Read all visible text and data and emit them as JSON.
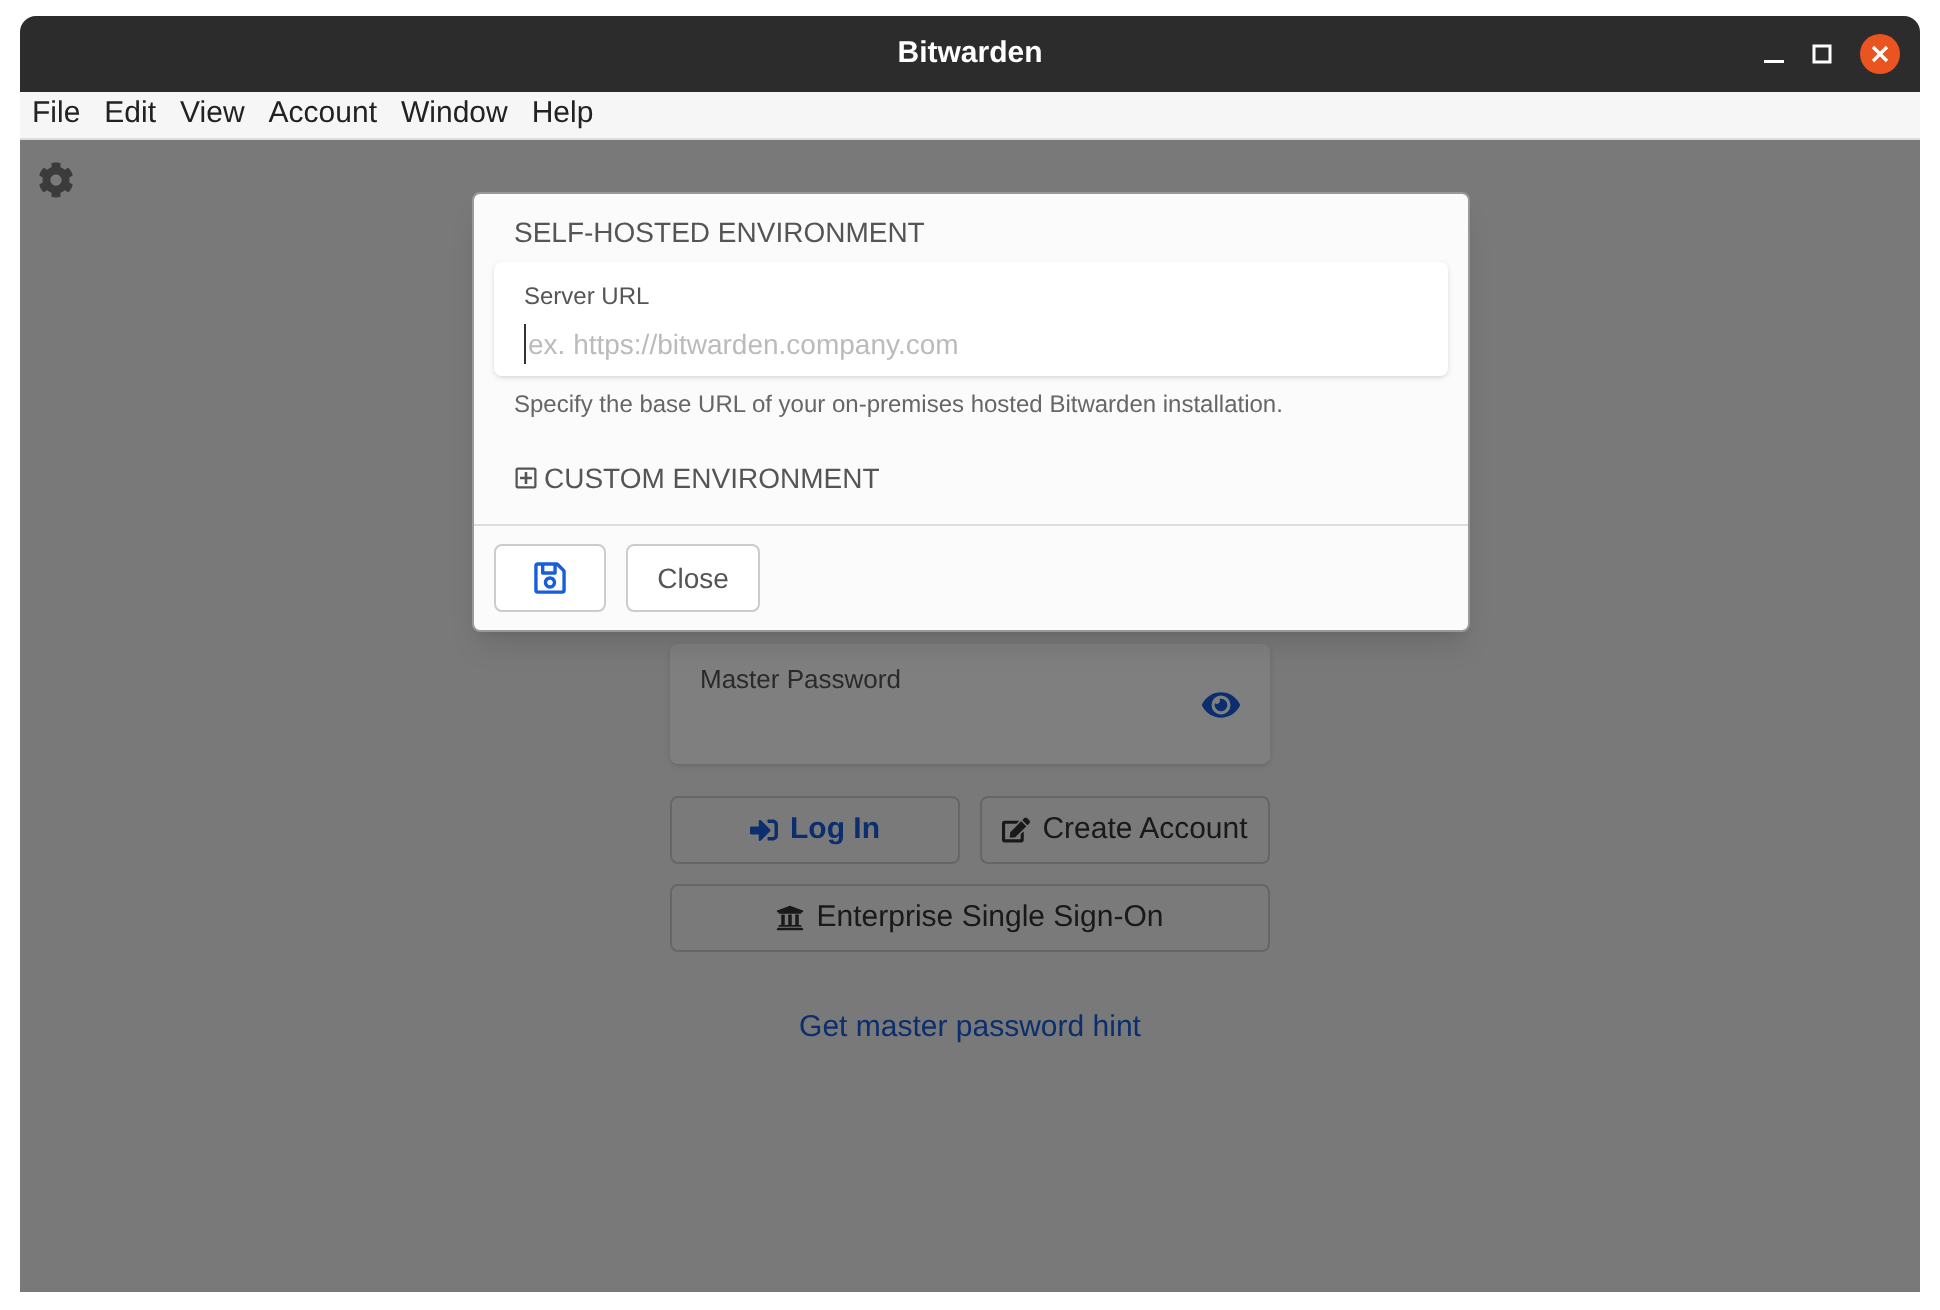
{
  "window": {
    "title": "Bitwarden"
  },
  "menu": [
    "File",
    "Edit",
    "View",
    "Account",
    "Window",
    "Help"
  ],
  "login": {
    "password_label": "Master Password",
    "buttons": [
      {
        "kind": "primary",
        "label": "Log In"
      },
      {
        "kind": "create",
        "label": "Create Account"
      },
      {
        "kind": "sso",
        "label": "Enterprise Single Sign-On"
      }
    ],
    "hint_link": "Get master password hint"
  },
  "dialog": {
    "title": "SELF-HOSTED ENVIRONMENT",
    "server_url": {
      "label": "Server URL",
      "placeholder": "ex. https://bitwarden.company.com"
    },
    "help": "Specify the base URL of your on-premises hosted Bitwarden installation.",
    "custom_environment": {
      "label": "CUSTOM ENVIRONMENT",
      "expanded": false
    },
    "close_button": "Close"
  }
}
